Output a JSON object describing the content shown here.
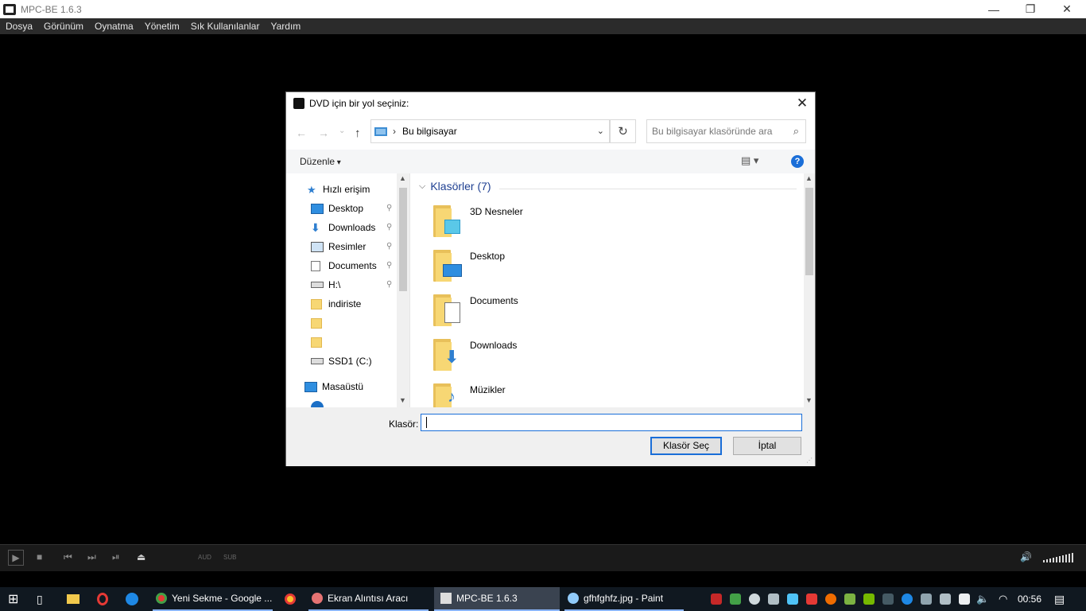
{
  "window": {
    "title": "MPC-BE 1.6.3",
    "minimize": "—",
    "restore": "❐",
    "close": "✕"
  },
  "menu": [
    "Dosya",
    "Görünüm",
    "Oynatma",
    "Yönetim",
    "Sık Kullanılanlar",
    "Yardım"
  ],
  "dialog": {
    "title": "DVD için bir yol seçiniz:",
    "close": "✕",
    "back": "←",
    "forward": "→",
    "recent": "⌄",
    "up": "↑",
    "address": {
      "sep": "›",
      "text": "Bu bilgisayar",
      "dropdown": "⌄"
    },
    "refresh": "↻",
    "search": {
      "placeholder": "Bu bilgisayar klasöründe ara",
      "icon": "⌕"
    },
    "toolbar": {
      "organize": "Düzenle",
      "view": "▤ ▾",
      "help": "?"
    },
    "nav": [
      {
        "label": "Hızlı erişim",
        "icon": "star-icon",
        "pinned": false
      },
      {
        "label": "Desktop",
        "icon": "desktop-icon",
        "pinned": true
      },
      {
        "label": "Downloads",
        "icon": "download-icon",
        "pinned": true
      },
      {
        "label": "Resimler",
        "icon": "pictures-icon",
        "pinned": true
      },
      {
        "label": "Documents",
        "icon": "documents-icon",
        "pinned": true
      },
      {
        "label": "H:\\",
        "icon": "drive-icon",
        "pinned": true
      },
      {
        "label": "indiriste",
        "icon": "folder-icon",
        "pinned": false
      },
      {
        "label": "",
        "icon": "folder-icon",
        "pinned": false
      },
      {
        "label": "",
        "icon": "folder-icon",
        "pinned": false
      },
      {
        "label": "SSD1 (C:)",
        "icon": "drive-icon",
        "pinned": false
      },
      {
        "label": "Masaüstü",
        "icon": "desktop-icon",
        "pinned": false
      }
    ],
    "pin": "📌",
    "group": {
      "chevron": "⌵",
      "label": "Klasörler (7)"
    },
    "folders": [
      {
        "label": "3D Nesneler",
        "badge": "cube"
      },
      {
        "label": "Desktop",
        "badge": "desktop"
      },
      {
        "label": "Documents",
        "badge": "document"
      },
      {
        "label": "Downloads",
        "badge": "download"
      },
      {
        "label": "Müzikler",
        "badge": "music"
      }
    ],
    "folder_label": "Klasör:",
    "folder_value": "",
    "ok": "Klasör Seç",
    "cancel": "İptal"
  },
  "player": {
    "aud": "AUD",
    "sub": "SUB"
  },
  "taskbar": {
    "items": [
      "Yeni Sekme - Google ...",
      "Ekran Alıntısı Aracı",
      "MPC-BE 1.6.3",
      "gfhfghfz.jpg - Paint"
    ],
    "clock": "00:56"
  }
}
